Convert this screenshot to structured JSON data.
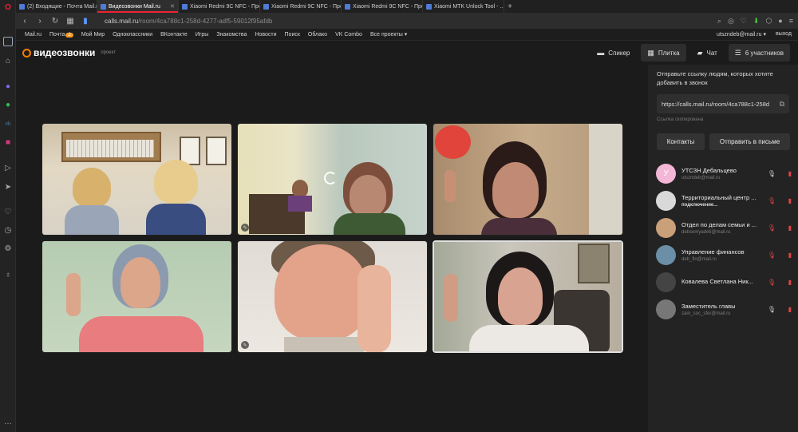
{
  "browser": {
    "tabs": [
      {
        "title": "(2) Входящие - Почта Mail.ru",
        "active": false
      },
      {
        "title": "Видеозвонки Mail.ru",
        "active": true
      },
      {
        "title": "Xiaomi Redmi 9C NFC - Про",
        "active": false
      },
      {
        "title": "Xiaomi Redmi 9C NFC - Про",
        "active": false
      },
      {
        "title": "Xiaomi Redmi 9C NFC - Про",
        "active": false
      },
      {
        "title": "Xiaomi MTK Unlock Tool - ...",
        "active": false
      }
    ],
    "url_host": "calls.mail.ru",
    "url_path": "/room/4ca788c1-258d-4277-adf5-59012f95afdb"
  },
  "mailbar": {
    "links": [
      "Mail.ru",
      "Почта",
      "Мой Мир",
      "Одноклассники",
      "ВКонтакте",
      "Игры",
      "Знакомства",
      "Новости",
      "Поиск",
      "Облако",
      "VK Combo",
      "Все проекты ▾"
    ],
    "mail_badge": "2",
    "user": "utszndeb@mail.ru ▾",
    "logout": "выход"
  },
  "app": {
    "logo_text": "видеозвонки",
    "logo_sub": "проект",
    "view_buttons": [
      {
        "label": "Спикер",
        "icon": "speaker-icon",
        "active": false
      },
      {
        "label": "Плитка",
        "icon": "grid-icon",
        "active": true
      },
      {
        "label": "Чат",
        "icon": "chat-icon",
        "active": false
      },
      {
        "label": "6 участников",
        "icon": "list-icon",
        "active": true
      }
    ]
  },
  "sidebar": {
    "share_text": "Отправьте ссылку людям, которых хотите добавить в звонок",
    "link": "https://calls.mail.ru/room/4ca788c1-258d",
    "copied": "Ссылка скопирована",
    "contacts_button": "Контакты",
    "send_button": "Отправить в письме",
    "participants": [
      {
        "name": "УТСЗН Дебальцево",
        "sub": "utszndeb@mail.ru",
        "avatar_letter": "У",
        "avatar_color": "#f3b6d6",
        "mic_muted": false,
        "status": false
      },
      {
        "name": "Территориальный центр ...",
        "sub": "подключение...",
        "avatar_letter": "",
        "avatar_color": "#d9d9d9",
        "mic_muted": true,
        "status": true
      },
      {
        "name": "Отдел по делам семьи и ...",
        "sub": "debsemyadeti@mail.ru",
        "avatar_letter": "",
        "avatar_color": "#caa07a",
        "mic_muted": true,
        "status": false
      },
      {
        "name": "Управление финансов",
        "sub": "deb_fin@mail.ru",
        "avatar_letter": "",
        "avatar_color": "#6c8fa8",
        "mic_muted": true,
        "status": false
      },
      {
        "name": "Ковалева Светлана Ник...",
        "sub": "",
        "avatar_letter": "",
        "avatar_color": "#444",
        "mic_muted": true,
        "status": false
      },
      {
        "name": "Заместитель главы",
        "sub": "zam_soc_sfer@mail.ru",
        "avatar_letter": "",
        "avatar_color": "#777",
        "mic_muted": false,
        "status": false
      }
    ]
  }
}
